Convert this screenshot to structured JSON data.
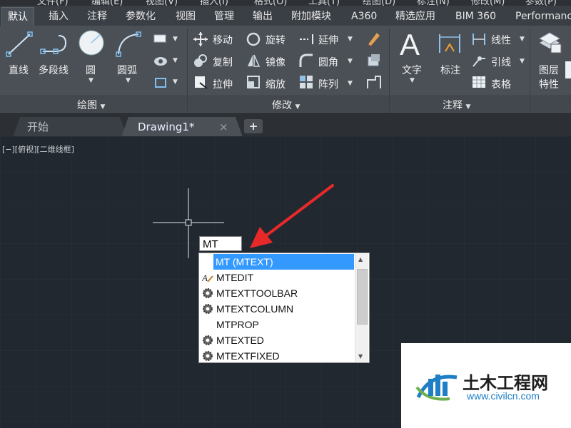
{
  "menubar": {
    "items": [
      "文件(F)",
      "编辑(E)",
      "视图(V)",
      "插入(I)",
      "格式(O)",
      "工具(T)",
      "绘图(D)",
      "标注(N)",
      "修改(M)",
      "参数(P)"
    ]
  },
  "ribbon_tabs": [
    "默认",
    "插入",
    "注释",
    "参数化",
    "视图",
    "管理",
    "输出",
    "附加模块",
    "A360",
    "精选应用",
    "BIM 360",
    "Performance"
  ],
  "draw_panel": {
    "title": "绘图",
    "buttons": {
      "line": "直线",
      "polyline": "多段线",
      "circle": "圆",
      "arc": "圆弧"
    }
  },
  "modify_panel": {
    "title": "修改",
    "buttons": {
      "move": "移动",
      "rotate": "旋转",
      "extend": "延伸",
      "copy": "复制",
      "mirror": "镜像",
      "fillet": "圆角",
      "stretch": "拉伸",
      "scale": "缩放",
      "array": "阵列"
    }
  },
  "annotation_panel": {
    "title": "注释",
    "buttons": {
      "text": "文字",
      "dimension": "标注",
      "linear": "线性",
      "leader": "引线",
      "table": "表格"
    }
  },
  "layers_panel": {
    "buttons": {
      "layer_props": "图层\n特性"
    },
    "layer_props_line1": "图层",
    "layer_props_line2": "特性"
  },
  "doc_tabs": {
    "start": "开始",
    "drawing": "Drawing1*",
    "close": "×",
    "new": "+"
  },
  "viewport_label": "[−][俯视][二维线框]",
  "command_input": {
    "value": "MT"
  },
  "autocomplete": {
    "items": [
      {
        "label": "MT (MTEXT)",
        "icon": "none",
        "selected": true
      },
      {
        "label": "MTEDIT",
        "icon": "text-edit-icon",
        "selected": false
      },
      {
        "label": "MTEXTTOOLBAR",
        "icon": "gear-icon",
        "selected": false
      },
      {
        "label": "MTEXTCOLUMN",
        "icon": "gear-icon",
        "selected": false
      },
      {
        "label": "MTPROP",
        "icon": "none",
        "selected": false
      },
      {
        "label": "MTEXTED",
        "icon": "gear-icon",
        "selected": false
      },
      {
        "label": "MTEXTFIXED",
        "icon": "gear-icon",
        "selected": false
      }
    ]
  },
  "watermark": {
    "name": "土木工程网",
    "url": "www.civilcn.com"
  },
  "colors": {
    "canvas": "#212830",
    "ribbon": "#4b5057",
    "selection": "#3399ff",
    "arrow": "#e8292a"
  }
}
